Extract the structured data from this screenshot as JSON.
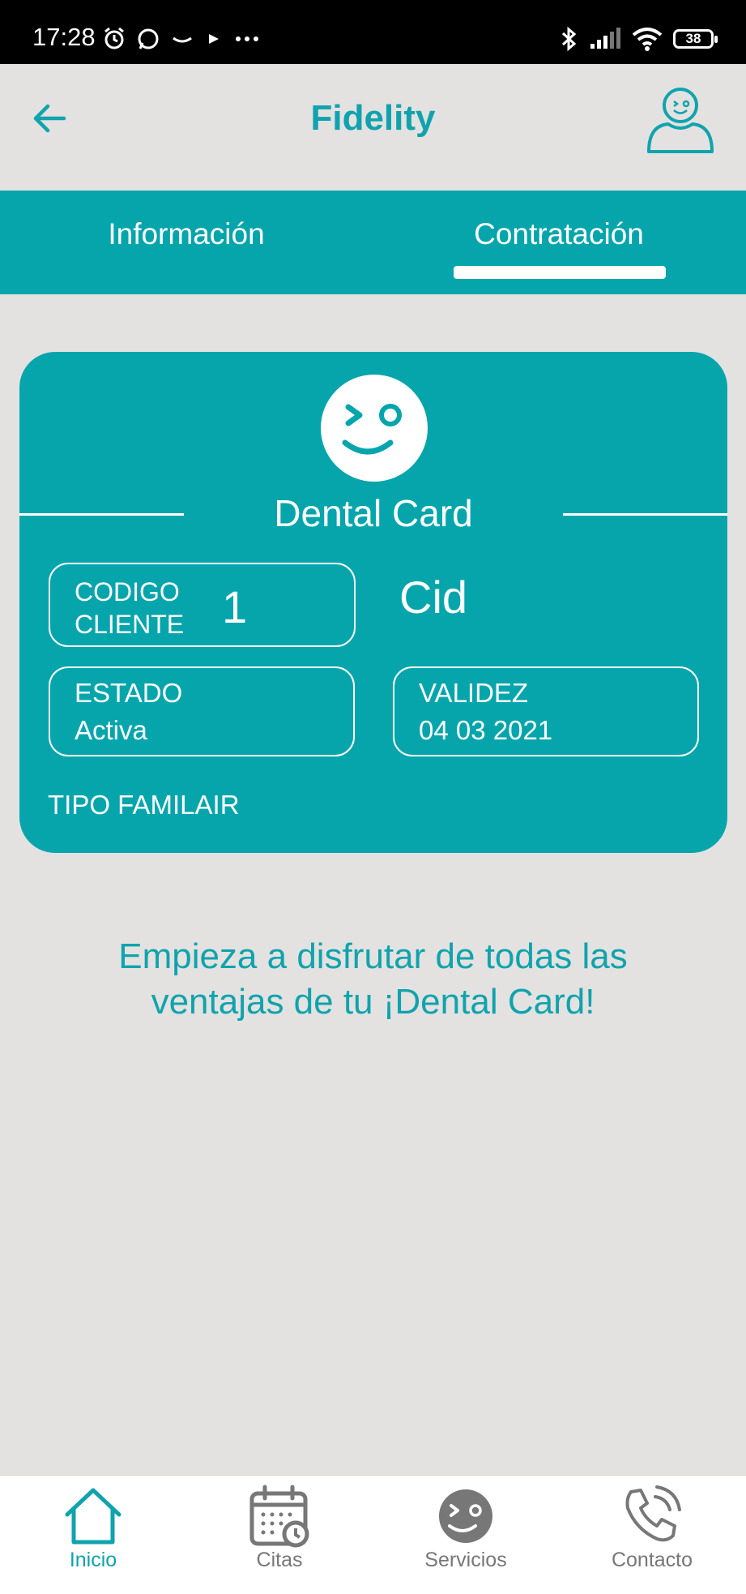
{
  "status_bar": {
    "time": "17:28",
    "battery": "38"
  },
  "header": {
    "title": "Fidelity"
  },
  "tabs": [
    {
      "label": "Información"
    },
    {
      "label": "Contratación"
    }
  ],
  "card": {
    "title": "Dental Card",
    "codigo_label_line1": "CODIGO",
    "codigo_label_line2": "CLIENTE",
    "codigo_value": "1",
    "cliente_name": "Cid",
    "estado_label": "ESTADO",
    "estado_value": "Activa",
    "validez_label": "VALIDEZ",
    "validez_value": "04 03 2021",
    "tipo": "TIPO FAMILAIR"
  },
  "promo": {
    "line1": "Empieza a disfrutar de todas las",
    "line2": "ventajas de tu ¡Dental Card!"
  },
  "bottom_nav": [
    {
      "label": "Inicio",
      "icon": "home-icon",
      "active": true
    },
    {
      "label": "Citas",
      "icon": "calendar-icon",
      "active": false
    },
    {
      "label": "Servicios",
      "icon": "smiley-icon",
      "active": false
    },
    {
      "label": "Contacto",
      "icon": "phone-icon",
      "active": false
    }
  ],
  "colors": {
    "accent": "#06a5ac",
    "text_accent": "#10a3ad",
    "background": "#e3e2e1"
  }
}
